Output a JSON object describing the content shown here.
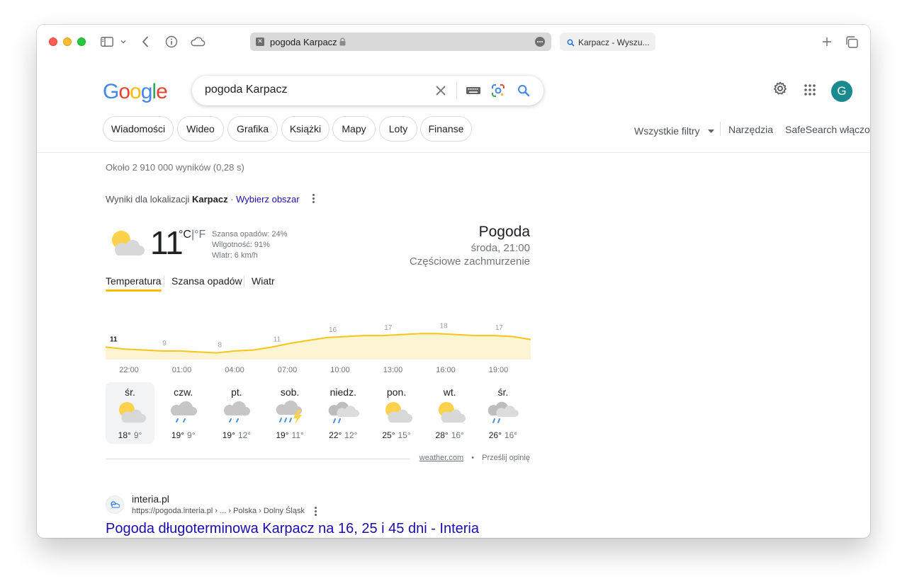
{
  "browser": {
    "active_tab": {
      "title": "pogoda Karpacz"
    },
    "inactive_tab": {
      "title": "Karpacz - Wyszu..."
    }
  },
  "google": {
    "logo_letters": [
      {
        "ch": "G",
        "color": "#4285f4"
      },
      {
        "ch": "o",
        "color": "#ea4335"
      },
      {
        "ch": "o",
        "color": "#fbbc05"
      },
      {
        "ch": "g",
        "color": "#4285f4"
      },
      {
        "ch": "l",
        "color": "#34a853"
      },
      {
        "ch": "e",
        "color": "#ea4335"
      }
    ],
    "search": {
      "value": "pogoda Karpacz"
    },
    "avatar_letter": "G",
    "chips": [
      "Wiadomości",
      "Wideo",
      "Grafika",
      "Książki",
      "Mapy",
      "Loty",
      "Finanse"
    ],
    "filters": {
      "all": "Wszystkie filtry",
      "tools": "Narzędzia",
      "safesearch": "SafeSearch włączony"
    }
  },
  "results": {
    "stats": "Około 2 910 000 wyników (0,28 s)",
    "location_prefix": "Wyniki dla lokalizacji",
    "location_name": "Karpacz",
    "location_sep": " · ",
    "location_link": "Wybierz obszar"
  },
  "weather": {
    "temp": "11",
    "unit_c": "°C",
    "unit_sep": "|",
    "unit_f": "°F",
    "precip": "Szansa opadów: 24%",
    "humidity": "Wilgotność: 91%",
    "wind": "Wiatr: 6 km/h",
    "title": "Pogoda",
    "time": "środa, 21:00",
    "condition": "Częściowe zachmurzenie",
    "tabs": [
      "Temperatura",
      "Szansa opadów",
      "Wiatr"
    ],
    "hours": [
      "22:00",
      "01:00",
      "04:00",
      "07:00",
      "10:00",
      "13:00",
      "16:00",
      "19:00"
    ],
    "days": [
      {
        "name": "śr.",
        "hi": "18°",
        "lo": "9°",
        "icon": "partly-cloudy-icon"
      },
      {
        "name": "czw.",
        "hi": "19°",
        "lo": "9°",
        "icon": "rain-cloud-icon"
      },
      {
        "name": "pt.",
        "hi": "19°",
        "lo": "12°",
        "icon": "rain-cloud-icon"
      },
      {
        "name": "sob.",
        "hi": "19°",
        "lo": "11°",
        "icon": "thunderstorm-icon"
      },
      {
        "name": "niedz.",
        "hi": "22°",
        "lo": "12°",
        "icon": "cloudy-rain-icon"
      },
      {
        "name": "pon.",
        "hi": "25°",
        "lo": "15°",
        "icon": "partly-cloudy-icon"
      },
      {
        "name": "wt.",
        "hi": "28°",
        "lo": "16°",
        "icon": "partly-cloudy-icon"
      },
      {
        "name": "śr.",
        "hi": "26°",
        "lo": "16°",
        "icon": "cloudy-rain-icon"
      }
    ],
    "footer_source": "weather.com",
    "footer_dot": "•",
    "footer_feedback": "Prześlij opinię",
    "chart_colors": {
      "line": "#f5c518",
      "fill": "#fdf4d3"
    }
  },
  "chart_data": {
    "type": "area",
    "x": [
      "22:00",
      "23:00",
      "00:00",
      "01:00",
      "02:00",
      "03:00",
      "04:00",
      "05:00",
      "06:00",
      "07:00",
      "08:00",
      "09:00",
      "10:00",
      "11:00",
      "12:00",
      "13:00",
      "14:00",
      "15:00",
      "16:00",
      "17:00",
      "18:00",
      "19:00",
      "20:00",
      "21:00"
    ],
    "series": [
      {
        "values": [
          11,
          10,
          9.5,
          9,
          9,
          8.5,
          8,
          9,
          9.5,
          11,
          13,
          14.5,
          16,
          16.5,
          17,
          17,
          17.5,
          18,
          18,
          17.5,
          17,
          17,
          16.5,
          15
        ]
      }
    ],
    "point_labels": [
      {
        "hour": "22:00",
        "value": 11
      },
      {
        "hour": "01:00",
        "value": 9
      },
      {
        "hour": "04:00",
        "value": 8
      },
      {
        "hour": "07:00",
        "value": 11
      },
      {
        "hour": "10:00",
        "value": 16
      },
      {
        "hour": "13:00",
        "value": 17
      },
      {
        "hour": "16:00",
        "value": 18
      },
      {
        "hour": "19:00",
        "value": 17
      }
    ],
    "ylim": [
      0,
      20
    ]
  },
  "result": {
    "site": "interia.pl",
    "url": "https://pogoda.interia.pl › ... › Polska › Dolny Śląsk",
    "title": "Pogoda długoterminowa Karpacz na 16, 25 i 45 dni - Interia"
  }
}
